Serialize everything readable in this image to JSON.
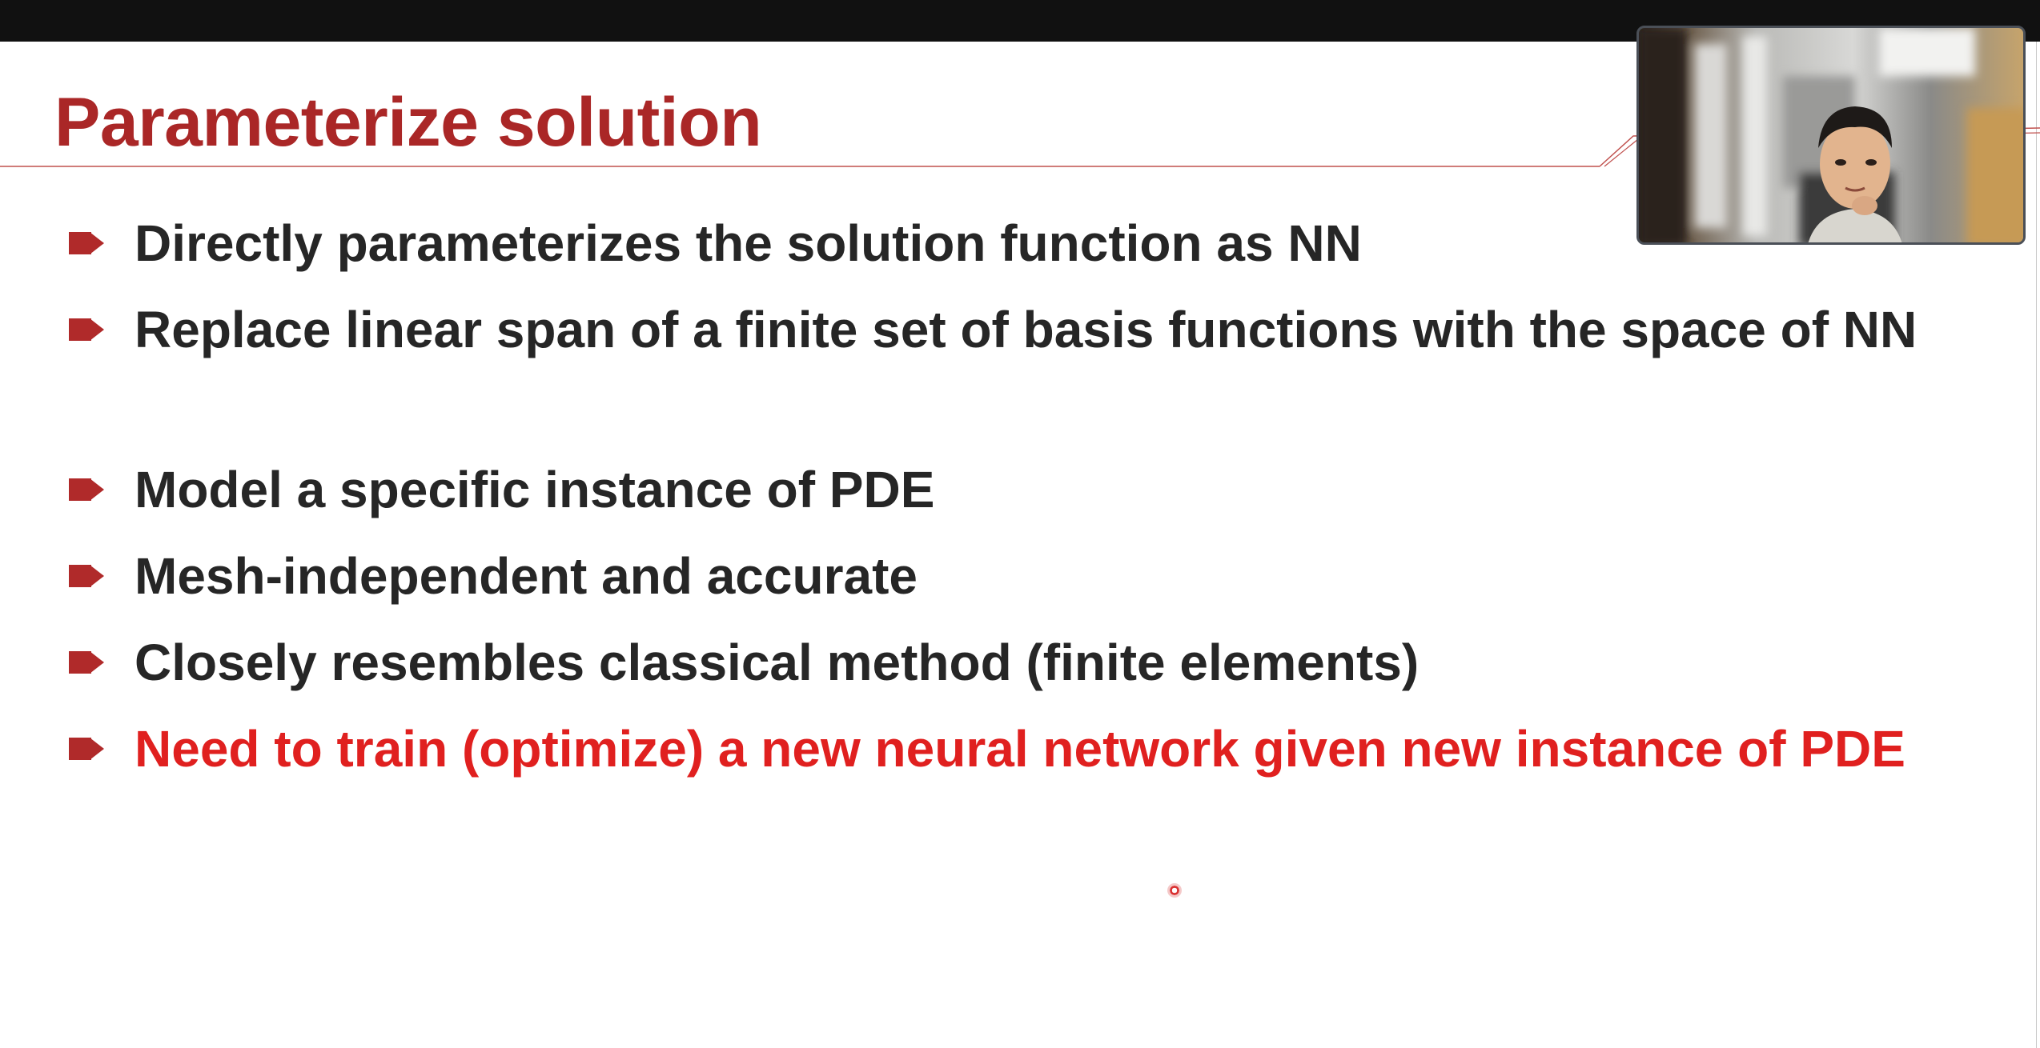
{
  "slide": {
    "title": "Parameterize solution",
    "bullets": [
      {
        "text": "Directly parameterizes the solution function as NN",
        "highlight": false
      },
      {
        "text": "Replace linear span of a finite set of basis functions with the space of NN",
        "highlight": false
      },
      {
        "text": "Model a specific instance of PDE",
        "highlight": false
      },
      {
        "text": "Mesh-independent and accurate",
        "highlight": false
      },
      {
        "text": "Closely resembles classical method (finite elements)",
        "highlight": false
      },
      {
        "text": "Need to train (optimize) a new neural network given new instance of PDE",
        "highlight": true
      }
    ]
  },
  "colors": {
    "title": "#aa2727",
    "bullet_marker": "#b02a2a",
    "body_text": "#262626",
    "highlight_text": "#e0201f",
    "top_bar": "#111111"
  },
  "icons": {
    "bullet": "arrow-square-bullet-icon",
    "cursor": "pointer-dot-icon"
  },
  "webcam": {
    "label": "participant video"
  }
}
